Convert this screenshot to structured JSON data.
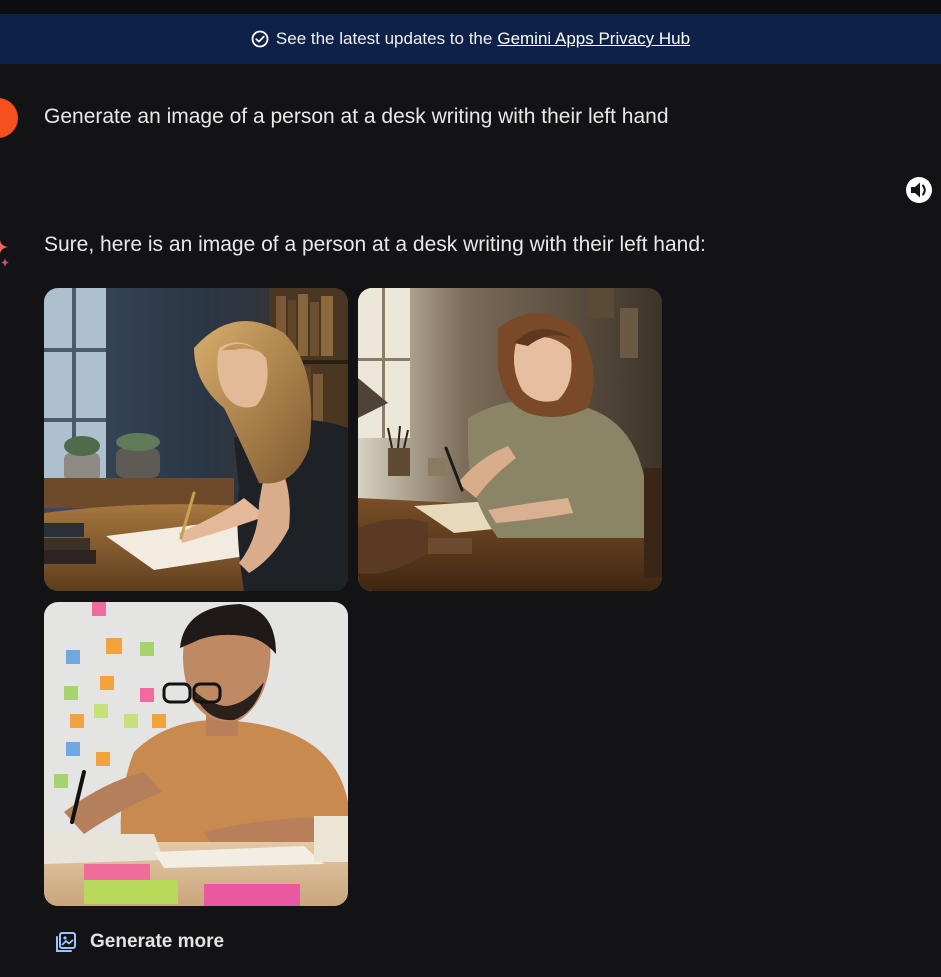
{
  "banner": {
    "text": "See the latest updates to the",
    "link": "Gemini Apps Privacy Hub",
    "icon": "check-badge-icon"
  },
  "user_prompt": "Generate an image of a person at a desk writing with their left hand",
  "response": {
    "text": "Sure, here is an image of a person at a desk writing with their left hand:",
    "images": [
      {
        "subject": "woman-blonde-writing-library"
      },
      {
        "subject": "woman-brown-hair-writing-warm-room"
      },
      {
        "subject": "man-glasses-writing-sticky-notes"
      }
    ],
    "generate_more": "Generate more"
  },
  "icons": {
    "speaker": "speaker-icon",
    "sparkle": "gemini-sparkle-icon",
    "generate_more": "image-stack-icon"
  },
  "colors": {
    "background": "#131316",
    "banner": "#0e2149",
    "avatar": "#f4511e",
    "text": "#e3e3e3"
  }
}
